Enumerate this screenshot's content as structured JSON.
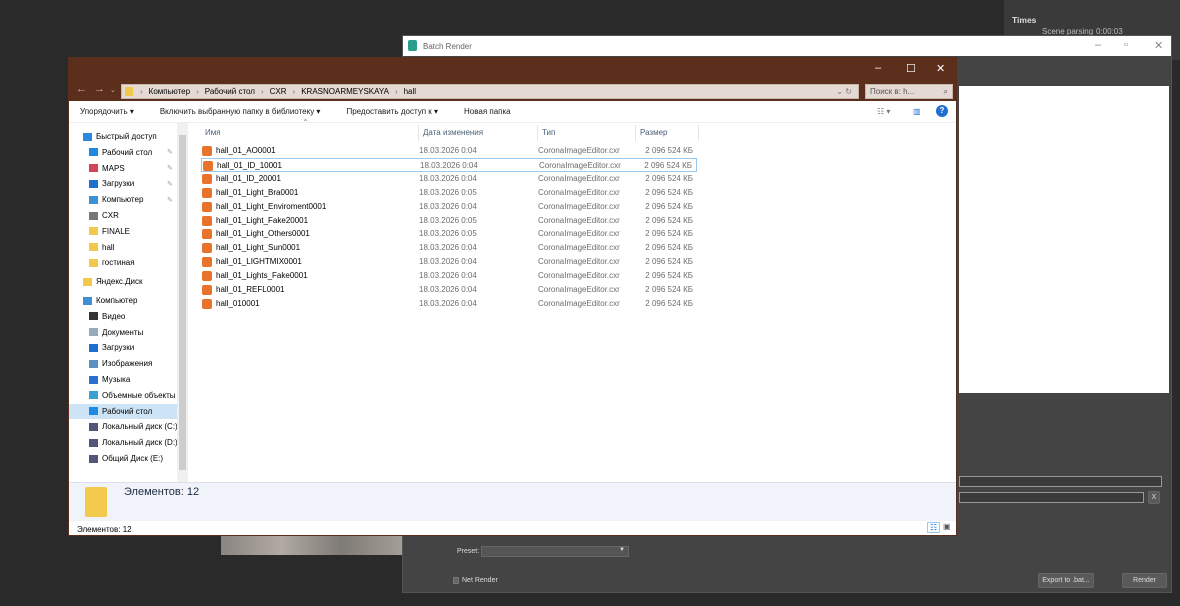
{
  "right_panel": {
    "title": "Times",
    "scene_parsing_label": "Scene parsing",
    "scene_parsing_value": "0:00:03"
  },
  "batch_render": {
    "title": "Batch Render",
    "preset_label": "Preset:",
    "preset_value": "",
    "net_render_label": "Net Render",
    "export_button": "Export to .bat...",
    "render_button": "Render",
    "clear_button": "X"
  },
  "explorer": {
    "breadcrumb": [
      "Компьютер",
      "Рабочий стол",
      "CXR",
      "KRASNOARMEYSKAYA",
      "hall"
    ],
    "search_placeholder": "Поиск в: h...",
    "toolbar": {
      "organize": "Упорядочить ▾",
      "include": "Включить выбранную папку в библиотеку ▾",
      "share": "Предоставить доступ к ▾",
      "new_folder": "Новая папка"
    },
    "sidebar": [
      {
        "label": "Быстрый доступ",
        "indent": 0,
        "color": "#2b8ae0",
        "pinned": false
      },
      {
        "label": "Рабочий стол",
        "indent": 1,
        "color": "#1e88e5",
        "pinned": true
      },
      {
        "label": "MAPS",
        "indent": 1,
        "color": "#d0455a",
        "pinned": true
      },
      {
        "label": "Загрузки",
        "indent": 1,
        "color": "#1e6fd0",
        "pinned": true
      },
      {
        "label": "Компьютер",
        "indent": 1,
        "color": "#3f8fd4",
        "pinned": true
      },
      {
        "label": "CXR",
        "indent": 1,
        "color": "#777",
        "pinned": false
      },
      {
        "label": "FINALE",
        "indent": 1,
        "color": "#f3c94d",
        "pinned": false
      },
      {
        "label": "hall",
        "indent": 1,
        "color": "#f3c94d",
        "pinned": false
      },
      {
        "label": "гостиная",
        "indent": 1,
        "color": "#f3c94d",
        "pinned": false
      },
      {
        "label": "Яндекс.Диск",
        "indent": 0,
        "color": "#f3c94d",
        "pinned": false
      },
      {
        "label": "Компьютер",
        "indent": 0,
        "color": "#3f8fd4",
        "pinned": false
      },
      {
        "label": "Видео",
        "indent": 1,
        "color": "#333",
        "pinned": false
      },
      {
        "label": "Документы",
        "indent": 1,
        "color": "#9ab",
        "pinned": false
      },
      {
        "label": "Загрузки",
        "indent": 1,
        "color": "#1e6fd0",
        "pinned": false
      },
      {
        "label": "Изображения",
        "indent": 1,
        "color": "#5a8fc0",
        "pinned": false
      },
      {
        "label": "Музыка",
        "indent": 1,
        "color": "#2b6fd0",
        "pinned": false
      },
      {
        "label": "Объемные объекты",
        "indent": 1,
        "color": "#3aa0d0",
        "pinned": false
      },
      {
        "label": "Рабочий стол",
        "indent": 1,
        "color": "#1e88e5",
        "pinned": false,
        "selected": true
      },
      {
        "label": "Локальный диск (C:)",
        "indent": 1,
        "color": "#557",
        "pinned": false
      },
      {
        "label": "Локальный диск (D:)",
        "indent": 1,
        "color": "#557",
        "pinned": false
      },
      {
        "label": "Общий Диск (E:)",
        "indent": 1,
        "color": "#557",
        "pinned": false
      }
    ],
    "columns": [
      "Имя",
      "Дата изменения",
      "Тип",
      "Размер"
    ],
    "files": [
      [
        "hall_01_AO0001",
        "18.03.2026 0:04",
        "CoronaImageEditor.cxr",
        "2 096 524 КБ"
      ],
      [
        "hall_01_ID_10001",
        "18.03.2026 0:04",
        "CoronaImageEditor.cxr",
        "2 096 524 КБ"
      ],
      [
        "hall_01_ID_20001",
        "18.03.2026 0:04",
        "CoronaImageEditor.cxr",
        "2 096 524 КБ"
      ],
      [
        "hall_01_Light_Bra0001",
        "18.03.2026 0:05",
        "CoronaImageEditor.cxr",
        "2 096 524 КБ"
      ],
      [
        "hall_01_Light_Enviroment0001",
        "18.03.2026 0:04",
        "CoronaImageEditor.cxr",
        "2 096 524 КБ"
      ],
      [
        "hall_01_Light_Fake20001",
        "18.03.2026 0:05",
        "CoronaImageEditor.cxr",
        "2 096 524 КБ"
      ],
      [
        "hall_01_Light_Others0001",
        "18.03.2026 0:05",
        "CoronaImageEditor.cxr",
        "2 096 524 КБ"
      ],
      [
        "hall_01_Light_Sun0001",
        "18.03.2026 0:04",
        "CoronaImageEditor.cxr",
        "2 096 524 КБ"
      ],
      [
        "hall_01_LIGHTMIX0001",
        "18.03.2026 0:04",
        "CoronaImageEditor.cxr",
        "2 096 524 КБ"
      ],
      [
        "hall_01_Lights_Fake0001",
        "18.03.2026 0:04",
        "CoronaImageEditor.cxr",
        "2 096 524 КБ"
      ],
      [
        "hall_01_REFL0001",
        "18.03.2026 0:04",
        "CoronaImageEditor.cxr",
        "2 096 524 КБ"
      ],
      [
        "hall_010001",
        "18.03.2026 0:04",
        "CoronaImageEditor.cxr",
        "2 096 524 КБ"
      ]
    ],
    "details_count": "Элементов: 12",
    "status": "Элементов: 12"
  }
}
